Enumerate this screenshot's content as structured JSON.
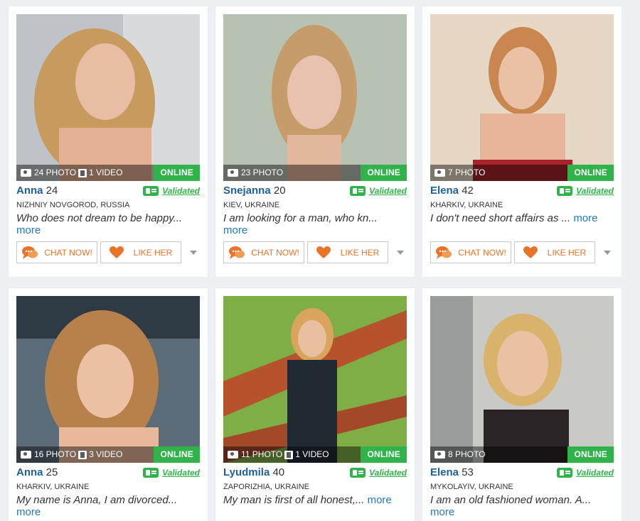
{
  "profiles": [
    {
      "name": "Anna",
      "age": "24",
      "photos": "24 PHOTO",
      "videos": "1 VIDEO",
      "status": "ONLINE",
      "validated": "Validated",
      "location": "NIZHNIY NOVGOROD, RUSSIA",
      "desc": "Who does not dream to be happy...",
      "more": "more",
      "chat": "CHAT NOW!",
      "like": "LIKE HER"
    },
    {
      "name": "Snejanna",
      "age": "20",
      "photos": "23 PHOTO",
      "status": "ONLINE",
      "validated": "Validated",
      "location": "KIEV, UKRAINE",
      "desc": "I am looking for a man, who kn...",
      "more": "more",
      "chat": "CHAT NOW!",
      "like": "LIKE HER"
    },
    {
      "name": "Elena",
      "age": "42",
      "photos": "7 PHOTO",
      "status": "ONLINE",
      "validated": "Validated",
      "location": "KHARKIV, UKRAINE",
      "desc": "I don't need short affairs as ...",
      "more": "more",
      "chat": "CHAT NOW!",
      "like": "LIKE HER"
    },
    {
      "name": "Anna",
      "age": "25",
      "photos": "16 PHOTO",
      "videos": "3 VIDEO",
      "status": "ONLINE",
      "validated": "Validated",
      "location": "KHARKIV, UKRAINE",
      "desc": "My name is Anna, I am divorced...",
      "more": "more"
    },
    {
      "name": "Lyudmila",
      "age": "40",
      "photos": "11 PHOTO",
      "videos": "1 VIDEO",
      "status": "ONLINE",
      "validated": "Validated",
      "location": "ZAPORIZHIA, UKRAINE",
      "desc": "My man is first of all honest,...",
      "more": "more"
    },
    {
      "name": "Elena",
      "age": "53",
      "photos": "8 PHOTO",
      "status": "ONLINE",
      "validated": "Validated",
      "location": "MYKOLAYIV, UKRAINE",
      "desc": "I am an old fashioned woman. A...",
      "more": "more"
    }
  ],
  "colors": {
    "name_blue": "#1f5f9a",
    "online_green": "#2fb34a",
    "accent_orange": "#e8742a",
    "link_blue": "#1f78c8"
  },
  "icons": [
    "camera-icon",
    "film-icon",
    "validated-badge-icon",
    "chat-bubble-icon",
    "heart-icon",
    "chevron-down-icon"
  ]
}
